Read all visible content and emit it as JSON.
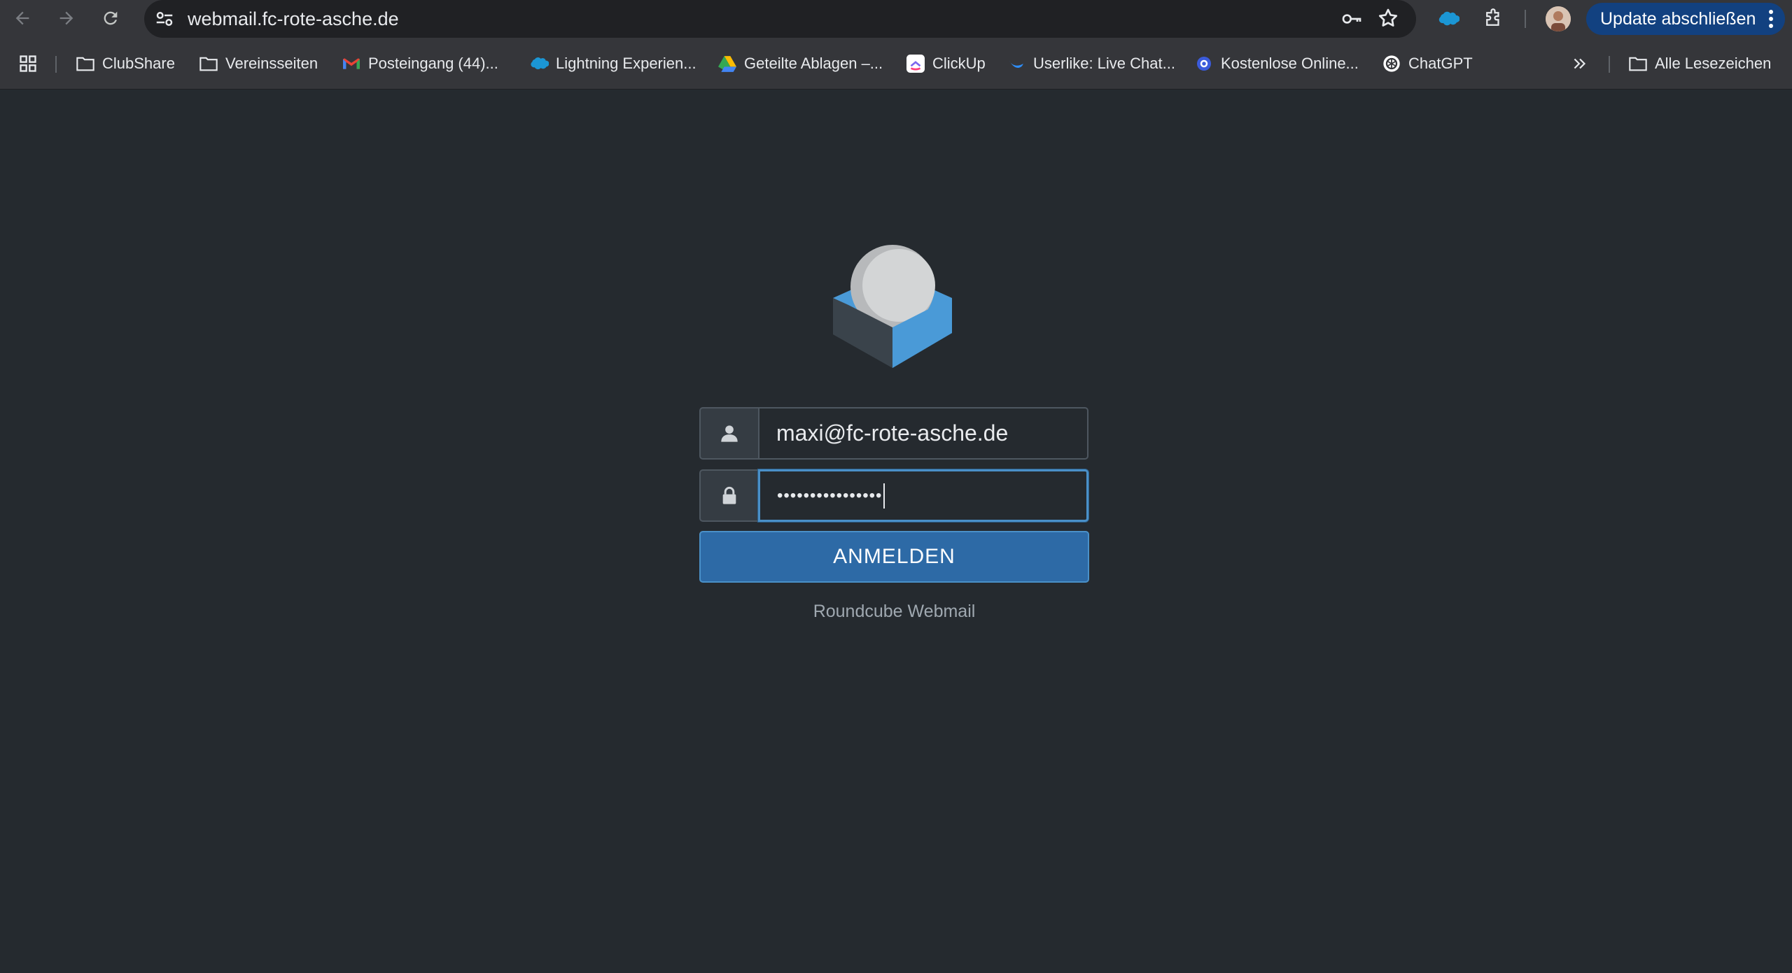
{
  "browser": {
    "url": "webmail.fc-rote-asche.de",
    "update_button": "Update abschließen",
    "icons": [
      "back-icon",
      "forward-icon",
      "reload-icon",
      "site-settings-icon",
      "password-key-icon",
      "bookmark-star-icon",
      "salesforce-extension-icon",
      "extensions-icon",
      "profile-avatar",
      "menu-icon"
    ]
  },
  "bookmarks": {
    "items": [
      {
        "label": "ClubShare",
        "icon": "folder-icon"
      },
      {
        "label": "Vereinsseiten",
        "icon": "folder-icon"
      },
      {
        "label": "Posteingang (44)...",
        "icon": "gmail-icon"
      },
      {
        "label": "Lightning Experien...",
        "icon": "salesforce-icon"
      },
      {
        "label": "Geteilte Ablagen –...",
        "icon": "google-drive-icon"
      },
      {
        "label": "ClickUp",
        "icon": "clickup-icon"
      },
      {
        "label": "Userlike: Live Chat...",
        "icon": "userlike-icon"
      },
      {
        "label": "Kostenlose Online...",
        "icon": "generic-site-icon"
      },
      {
        "label": "ChatGPT",
        "icon": "chatgpt-icon"
      }
    ],
    "all_bookmarks": "Alle Lesezeichen"
  },
  "login": {
    "username_value": "maxi@fc-rote-asche.de",
    "password_masked": "••••••••••••••••",
    "submit_label": "ANMELDEN",
    "footer": "Roundcube Webmail"
  },
  "colors": {
    "page_bg": "#252a2f",
    "button_bg": "#2d6aa6",
    "focus_border": "#4a90c8",
    "logo_blue": "#4a9ad7"
  }
}
